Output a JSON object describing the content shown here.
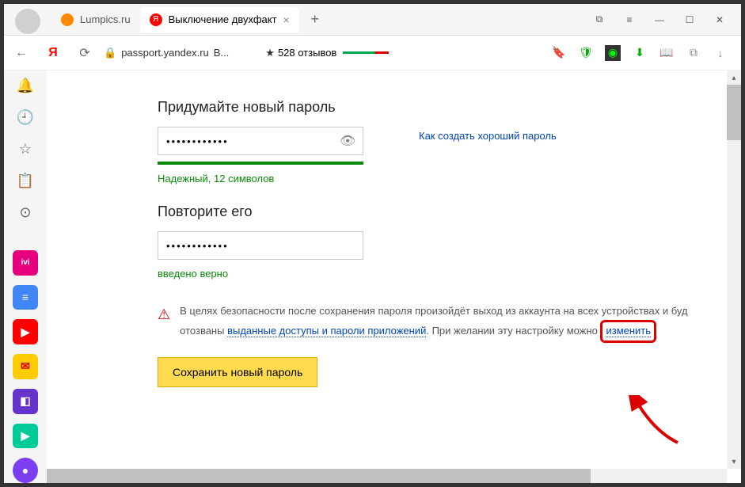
{
  "tabs": {
    "inactive": {
      "label": "Lumpics.ru",
      "favicon_color": "#ff8800"
    },
    "active": {
      "label": "Выключение двухфакт",
      "favicon_letter": "Я",
      "favicon_bg": "#ff0000"
    },
    "new_tab": "+"
  },
  "window_controls": {
    "collections": "⧉",
    "menu": "≡",
    "minimize": "—",
    "maximize": "☐",
    "close": "✕"
  },
  "nav": {
    "back": "←",
    "home": "Я",
    "reload": "⟳"
  },
  "url": {
    "lock": "🔒",
    "host": "passport.yandex.ru",
    "path": "В..."
  },
  "reviews": {
    "star": "★",
    "text": "528 отзывов"
  },
  "toolbar": {
    "bookmark": "🔖",
    "shield": "🛡",
    "adblock": "◉",
    "download_green": "⬇",
    "reader": "📖",
    "ext": "⧉",
    "download": "↓"
  },
  "sidebar": {
    "icons": [
      "🔔",
      "🕘",
      "☆",
      "📋",
      "⊙"
    ],
    "apps": [
      {
        "bg": "#e6007e",
        "label": "ivi"
      },
      {
        "bg": "#4285f4",
        "label": "≡"
      },
      {
        "bg": "#ff0000",
        "label": "▶"
      },
      {
        "bg": "#ffcc00",
        "label": "✉"
      },
      {
        "bg": "#6633cc",
        "label": "◧"
      },
      {
        "bg": "#00cc99",
        "label": "▶"
      },
      {
        "bg": "#7b3ff2",
        "label": "●"
      }
    ]
  },
  "form": {
    "title1": "Придумайте новый пароль",
    "password_value": "••••••••••••",
    "eye": "👁",
    "strength_label": "Надежный, 12 символов",
    "side_link": "Как создать хороший пароль",
    "title2": "Повторите его",
    "confirm_value": "••••••••••••",
    "confirm_label": "введено верно",
    "warning_icon": "⚠",
    "warning_text_1": "В целях безопасности после сохранения пароля произойдёт выход из аккаунта на всех устройствах и буд",
    "warning_text_2": "отозваны ",
    "warning_link": "выданные доступы и пароли приложений",
    "warning_text_3": ". При желании эту настройку можно ",
    "change_link": "изменить",
    "save_button": "Сохранить новый пароль"
  }
}
